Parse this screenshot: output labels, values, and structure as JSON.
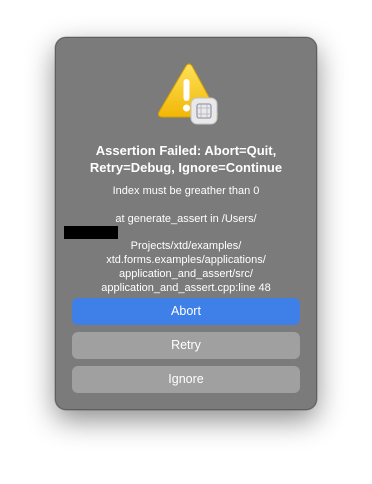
{
  "dialog": {
    "icon": "warning-triangle-icon",
    "badge_icon": "app-badge-icon",
    "title": "Assertion Failed: Abort=Quit, Retry=Debug, Ignore=Continue",
    "message": "Index must be greather than 0",
    "location_lines": [
      "at generate_assert in /Users/",
      "Projects/xtd/examples/",
      "xtd.forms.examples/applications/",
      "application_and_assert/src/",
      "application_and_assert.cpp:line 48"
    ],
    "buttons": {
      "abort": "Abort",
      "retry": "Retry",
      "ignore": "Ignore"
    }
  },
  "colors": {
    "dialog_bg": "#7b7b7b",
    "primary_button": "#3e7fe8",
    "secondary_button": "#a0a0a0",
    "warning_yellow": "#f5c518",
    "text": "#ffffff"
  }
}
